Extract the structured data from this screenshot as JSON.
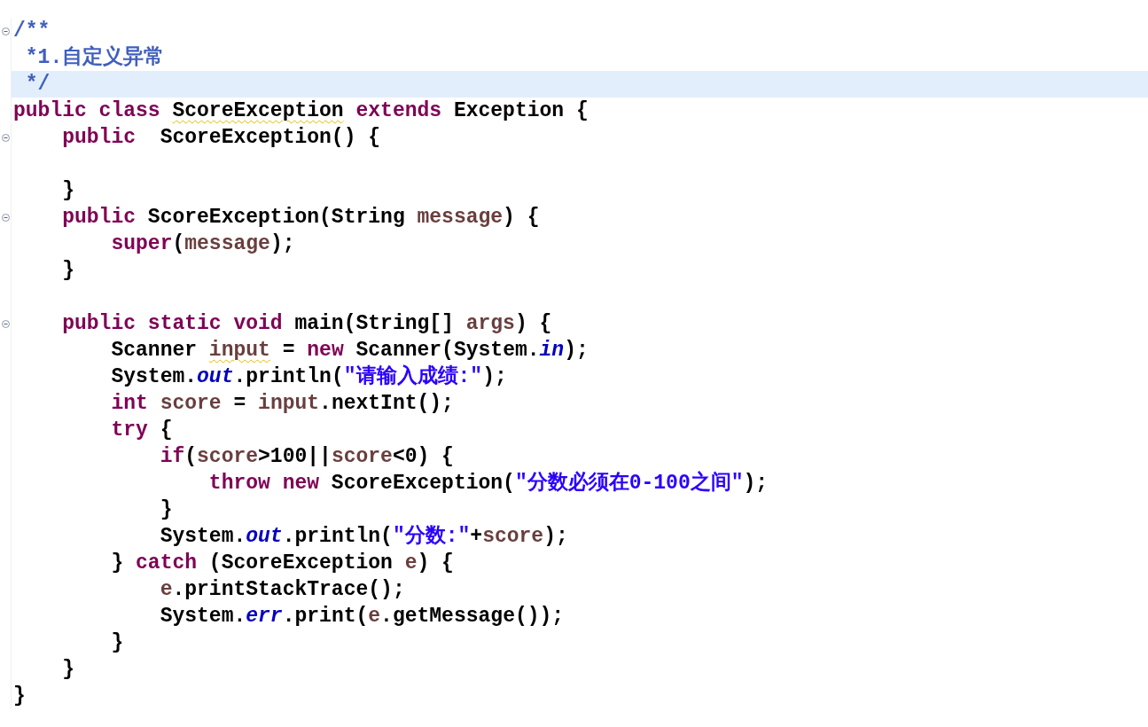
{
  "editor": {
    "lines": [
      {
        "fold_marker": true,
        "current": false,
        "tokens": [
          {
            "kind": "comment",
            "text": "/**"
          }
        ]
      },
      {
        "fold_marker": false,
        "current": false,
        "tokens": [
          {
            "kind": "comment",
            "text": " *1.自定义异常"
          }
        ]
      },
      {
        "fold_marker": false,
        "current": true,
        "tokens": [
          {
            "kind": "comment",
            "text": " */"
          }
        ]
      },
      {
        "fold_marker": false,
        "current": false,
        "tokens": [
          {
            "kind": "keyword",
            "text": "public class "
          },
          {
            "kind": "warning",
            "text": "ScoreException"
          },
          {
            "kind": "keyword",
            "text": " extends"
          },
          {
            "kind": "text",
            "text": " Exception {"
          }
        ]
      },
      {
        "fold_marker": true,
        "current": false,
        "tokens": [
          {
            "kind": "keyword",
            "text": "    public"
          },
          {
            "kind": "text",
            "text": "  ScoreException() {"
          }
        ]
      },
      {
        "fold_marker": false,
        "current": false
      },
      {
        "fold_marker": false,
        "current": false,
        "tokens": [
          {
            "kind": "text",
            "text": "    }"
          }
        ]
      },
      {
        "fold_marker": true,
        "current": false,
        "tokens": [
          {
            "kind": "keyword",
            "text": "    public"
          },
          {
            "kind": "text",
            "text": " ScoreException(String "
          },
          {
            "kind": "variable",
            "text": "message"
          },
          {
            "kind": "text",
            "text": ") {"
          }
        ]
      },
      {
        "fold_marker": false,
        "current": false,
        "tokens": [
          {
            "kind": "keyword",
            "text": "        super"
          },
          {
            "kind": "text",
            "text": "("
          },
          {
            "kind": "variable",
            "text": "message"
          },
          {
            "kind": "text",
            "text": ");"
          }
        ]
      },
      {
        "fold_marker": false,
        "current": false,
        "tokens": [
          {
            "kind": "text",
            "text": "    }"
          }
        ]
      },
      {
        "fold_marker": false,
        "current": false
      },
      {
        "fold_marker": true,
        "current": false,
        "tokens": [
          {
            "kind": "keyword",
            "text": "    public static void"
          },
          {
            "kind": "text",
            "text": " main(String[] "
          },
          {
            "kind": "variable",
            "text": "args"
          },
          {
            "kind": "text",
            "text": ") {"
          }
        ]
      },
      {
        "fold_marker": false,
        "current": false,
        "tokens": [
          {
            "kind": "text",
            "text": "        Scanner "
          },
          {
            "kind": "variable-warning",
            "text": "input"
          },
          {
            "kind": "text",
            "text": " = "
          },
          {
            "kind": "keyword",
            "text": "new"
          },
          {
            "kind": "text",
            "text": " Scanner(System."
          },
          {
            "kind": "field",
            "text": "in"
          },
          {
            "kind": "text",
            "text": ");"
          }
        ]
      },
      {
        "fold_marker": false,
        "current": false,
        "tokens": [
          {
            "kind": "text",
            "text": "        System."
          },
          {
            "kind": "field",
            "text": "out"
          },
          {
            "kind": "text",
            "text": ".println("
          },
          {
            "kind": "string",
            "text": "\"请输入成绩:\""
          },
          {
            "kind": "text",
            "text": ");"
          }
        ]
      },
      {
        "fold_marker": false,
        "current": false,
        "tokens": [
          {
            "kind": "keyword",
            "text": "        int"
          },
          {
            "kind": "variable",
            "text": " score"
          },
          {
            "kind": "text",
            "text": " = "
          },
          {
            "kind": "variable",
            "text": "input"
          },
          {
            "kind": "text",
            "text": ".nextInt();"
          }
        ]
      },
      {
        "fold_marker": false,
        "current": false,
        "tokens": [
          {
            "kind": "keyword",
            "text": "        try"
          },
          {
            "kind": "text",
            "text": " {"
          }
        ]
      },
      {
        "fold_marker": false,
        "current": false,
        "tokens": [
          {
            "kind": "keyword",
            "text": "            if"
          },
          {
            "kind": "text",
            "text": "("
          },
          {
            "kind": "variable",
            "text": "score"
          },
          {
            "kind": "text",
            "text": ">100||"
          },
          {
            "kind": "variable",
            "text": "score"
          },
          {
            "kind": "text",
            "text": "<0) {"
          }
        ]
      },
      {
        "fold_marker": false,
        "current": false,
        "tokens": [
          {
            "kind": "keyword",
            "text": "                throw new"
          },
          {
            "kind": "text",
            "text": " ScoreException("
          },
          {
            "kind": "string",
            "text": "\"分数必须在0-100之间\""
          },
          {
            "kind": "text",
            "text": ");"
          }
        ]
      },
      {
        "fold_marker": false,
        "current": false,
        "tokens": [
          {
            "kind": "text",
            "text": "            }"
          }
        ]
      },
      {
        "fold_marker": false,
        "current": false,
        "tokens": [
          {
            "kind": "text",
            "text": "            System."
          },
          {
            "kind": "field",
            "text": "out"
          },
          {
            "kind": "text",
            "text": ".println("
          },
          {
            "kind": "string",
            "text": "\"分数:\""
          },
          {
            "kind": "text",
            "text": "+"
          },
          {
            "kind": "variable",
            "text": "score"
          },
          {
            "kind": "text",
            "text": ");"
          }
        ]
      },
      {
        "fold_marker": false,
        "current": false,
        "tokens": [
          {
            "kind": "text",
            "text": "        } "
          },
          {
            "kind": "keyword",
            "text": "catch"
          },
          {
            "kind": "text",
            "text": " (ScoreException "
          },
          {
            "kind": "variable",
            "text": "e"
          },
          {
            "kind": "text",
            "text": ") {"
          }
        ]
      },
      {
        "fold_marker": false,
        "current": false,
        "tokens": [
          {
            "kind": "variable",
            "text": "            e"
          },
          {
            "kind": "text",
            "text": ".printStackTrace();"
          }
        ]
      },
      {
        "fold_marker": false,
        "current": false,
        "tokens": [
          {
            "kind": "text",
            "text": "            System."
          },
          {
            "kind": "field",
            "text": "err"
          },
          {
            "kind": "text",
            "text": ".print("
          },
          {
            "kind": "variable",
            "text": "e"
          },
          {
            "kind": "text",
            "text": ".getMessage());"
          }
        ]
      },
      {
        "fold_marker": false,
        "current": false,
        "tokens": [
          {
            "kind": "text",
            "text": "        }"
          }
        ]
      },
      {
        "fold_marker": false,
        "current": false,
        "tokens": [
          {
            "kind": "text",
            "text": "    }"
          }
        ]
      },
      {
        "fold_marker": false,
        "current": false,
        "tokens": [
          {
            "kind": "text",
            "text": "}"
          }
        ]
      }
    ]
  }
}
